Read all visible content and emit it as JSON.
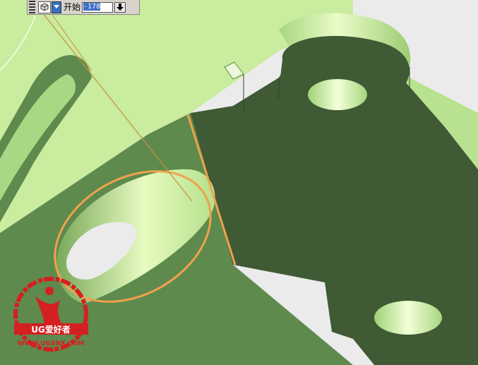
{
  "toolbar": {
    "label": "开始",
    "value": "-178",
    "view_icon": "cube-view-icon",
    "dropdown_icon": "chevron-down-icon",
    "spin_icon": "spin-down-icon"
  },
  "watermark": {
    "brand": "UG爱好者",
    "url": "WWW.UGSNX.COM"
  },
  "colors": {
    "background": "#ebebeb",
    "face_light": "#c9ec9f",
    "face_mid": "#5e8a4e",
    "face_dark": "#3f5a35",
    "edge_highlight": "#f0a24a",
    "watermark": "#d42020"
  }
}
